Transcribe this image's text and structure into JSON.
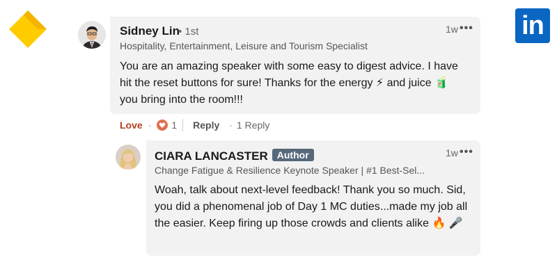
{
  "brand": {
    "left_icon": "yellow-diamond-logo",
    "right_icon": "linkedin-logo",
    "right_text": "in",
    "linkedin_blue": "#0a66c2",
    "logo_yellow": "#ffcc00"
  },
  "comment": {
    "author": "Sidney Lin",
    "degree": "• 1st",
    "headline": "Hospitality, Entertainment, Leisure and Tourism Specialist",
    "time": "1w",
    "more": "•••",
    "text": "You are an amazing speaker with some easy to digest advice. I have hit the reset buttons for sure! Thanks for the energy ⚡ and juice 🧃 you bring into the room!!!"
  },
  "actions": {
    "love": "Love",
    "dot": "·",
    "reaction_count": "1",
    "reply": "Reply",
    "replies": "1 Reply"
  },
  "reply": {
    "author": "CIARA LANCASTER",
    "badge": "Author",
    "headline": "Change Fatigue & Resilience Keynote Speaker | #1 Best-Sel...",
    "time": "1w",
    "more": "•••",
    "text": "Woah, talk about next-level feedback! Thank you so much. Sid, you did a phenomenal job of Day 1 MC duties...made my job all the easier. Keep firing up those crowds and clients alike 🔥 🎤"
  },
  "colors": {
    "bubble": "#f2f2f2",
    "love": "#b24020",
    "badge": "#56687a"
  }
}
